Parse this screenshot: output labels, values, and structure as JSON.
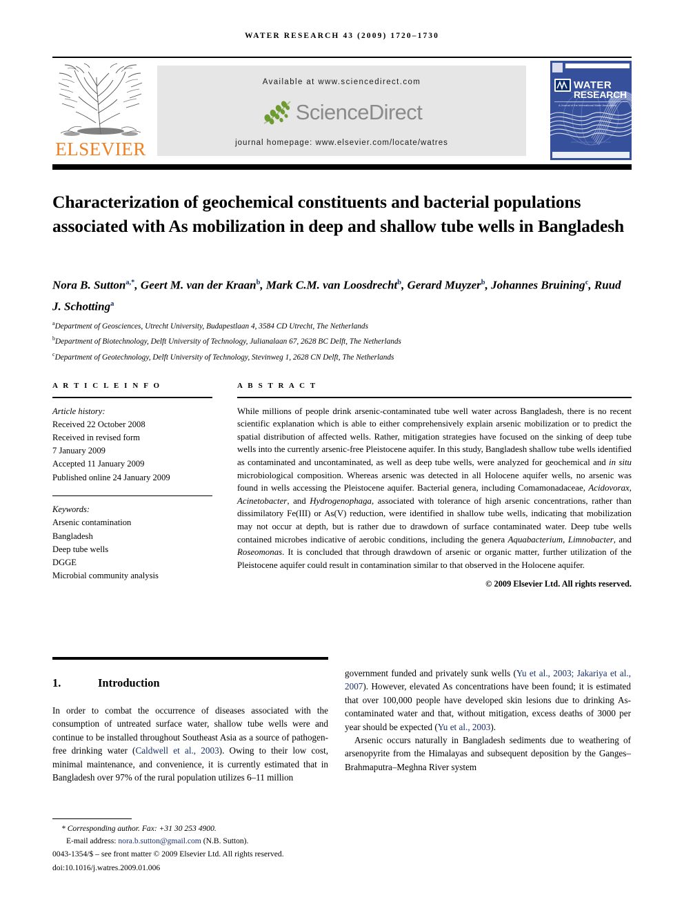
{
  "masthead": {
    "running_head": "WATER RESEARCH 43 (2009) 1720–1730",
    "elsevier_wordmark": "ELSEVIER",
    "elsevier_color": "#F08122",
    "available_at": "Available at www.sciencedirect.com",
    "sciencedirect_wordmark": "ScienceDirect",
    "sciencedirect_text_color": "#8a8a8a",
    "sciencedirect_leaf_color": "#6D9B2F",
    "journal_homepage": "journal homepage: www.elsevier.com/locate/watres",
    "cover": {
      "line1": "WATER",
      "line2": "RESEARCH",
      "imprint": "A Journal of the International Water Association",
      "iwa_badge": "IWA",
      "background_color": "#37509B"
    }
  },
  "article": {
    "title": "Characterization of geochemical constituents and bacterial populations associated with As mobilization in deep and shallow tube wells in Bangladesh",
    "authors_line1": "Nora B. Sutton",
    "authors_html": "Nora B. Sutton<sup>a,*</sup>, Geert M. van der Kraan<sup>b</sup>, Mark C.M. van Loosdrecht<sup>b</sup>, Gerard Muyzer<sup>b</sup>, Johannes Bruining<sup>c</sup>, Ruud J. Schotting<sup>a</sup>",
    "affiliations": [
      "Department of Geosciences, Utrecht University, Budapestlaan 4, 3584 CD Utrecht, The Netherlands",
      "Department of Biotechnology, Delft University of Technology, Julianalaan 67, 2628 BC Delft, The Netherlands",
      "Department of Geotechnology, Delft University of Technology, Stevinweg 1, 2628 CN Delft, The Netherlands"
    ],
    "affiliation_markers": [
      "a",
      "b",
      "c"
    ]
  },
  "article_info": {
    "heading": "A R T I C L E   I N F O",
    "history_label": "Article history:",
    "history": [
      "Received 22 October 2008",
      "Received in revised form",
      "7 January 2009",
      "Accepted 11 January 2009",
      "Published online 24 January 2009"
    ],
    "keywords_label": "Keywords:",
    "keywords": [
      "Arsenic contamination",
      "Bangladesh",
      "Deep tube wells",
      "DGGE",
      "Microbial community analysis"
    ]
  },
  "abstract": {
    "heading": "A B S T R A C T",
    "body_html": "While millions of people drink arsenic-contaminated tube well water across Bangladesh, there is no recent scientific explanation which is able to either comprehensively explain arsenic mobilization or to predict the spatial distribution of affected wells. Rather, mitigation strategies have focused on the sinking of deep tube wells into the currently arsenic-free Pleistocene aquifer. In this study, Bangladesh shallow tube wells identified as contaminated and uncontaminated, as well as deep tube wells, were analyzed for geochemical and <i>in situ</i> microbiological composition. Whereas arsenic was detected in all Holocene aquifer wells, no arsenic was found in wells accessing the Pleistocene aquifer. Bacterial genera, including Comamonadaceae, <i>Acidovorax</i>, <i>Acinetobacter</i>, and <i>Hydrogenophaga</i>, associated with tolerance of high arsenic concentrations, rather than dissimilatory Fe(III) or As(V) reduction, were identified in shallow tube wells, indicating that mobilization may not occur at depth, but is rather due to drawdown of surface contaminated water. Deep tube wells contained microbes indicative of aerobic conditions, including the genera <i>Aquabacterium</i>, <i>Limnobacter</i>, and <i>Roseomonas</i>. It is concluded that through drawdown of arsenic or organic matter, further utilization of the Pleistocene aquifer could result in contamination similar to that observed in the Holocene aquifer.",
    "copyright": "© 2009 Elsevier Ltd. All rights reserved."
  },
  "introduction": {
    "number": "1.",
    "heading": "Introduction",
    "left_html": "In order to combat the occurrence of diseases associated with the consumption of untreated surface water, shallow tube wells were and continue to be installed throughout Southeast Asia as a source of pathogen-free drinking water (<span class=\"cite\">Caldwell et al., 2003</span>). Owing to their low cost, minimal maintenance, and convenience, it is currently estimated that in Bangladesh over 97% of the rural population utilizes 6–11 million",
    "right_html_p1": "government funded and privately sunk wells (<span class=\"cite\">Yu et al., 2003; Jakariya et al., 2007</span>). However, elevated As concentrations have been found; it is estimated that over 100,000 people have developed skin lesions due to drinking As-contaminated water and that, without mitigation, excess deaths of 3000 per year should be expected (<span class=\"cite\">Yu et al., 2003</span>).",
    "right_html_p2": "Arsenic occurs naturally in Bangladesh sediments due to weathering of arsenopyrite from the Himalayas and subsequent deposition by the Ganges–Brahmaputra–Meghna River system"
  },
  "footnote": {
    "corresponding_html": "* <i>Corresponding author</i>. Fax: +31 30 253 4900.",
    "email_html": "E-mail address: <span class=\"email\">nora.b.sutton@gmail.com</span> (N.B. Sutton).",
    "front_matter": "0043-1354/$ – see front matter © 2009 Elsevier Ltd. All rights reserved.",
    "doi": "doi:10.1016/j.watres.2009.01.006"
  }
}
